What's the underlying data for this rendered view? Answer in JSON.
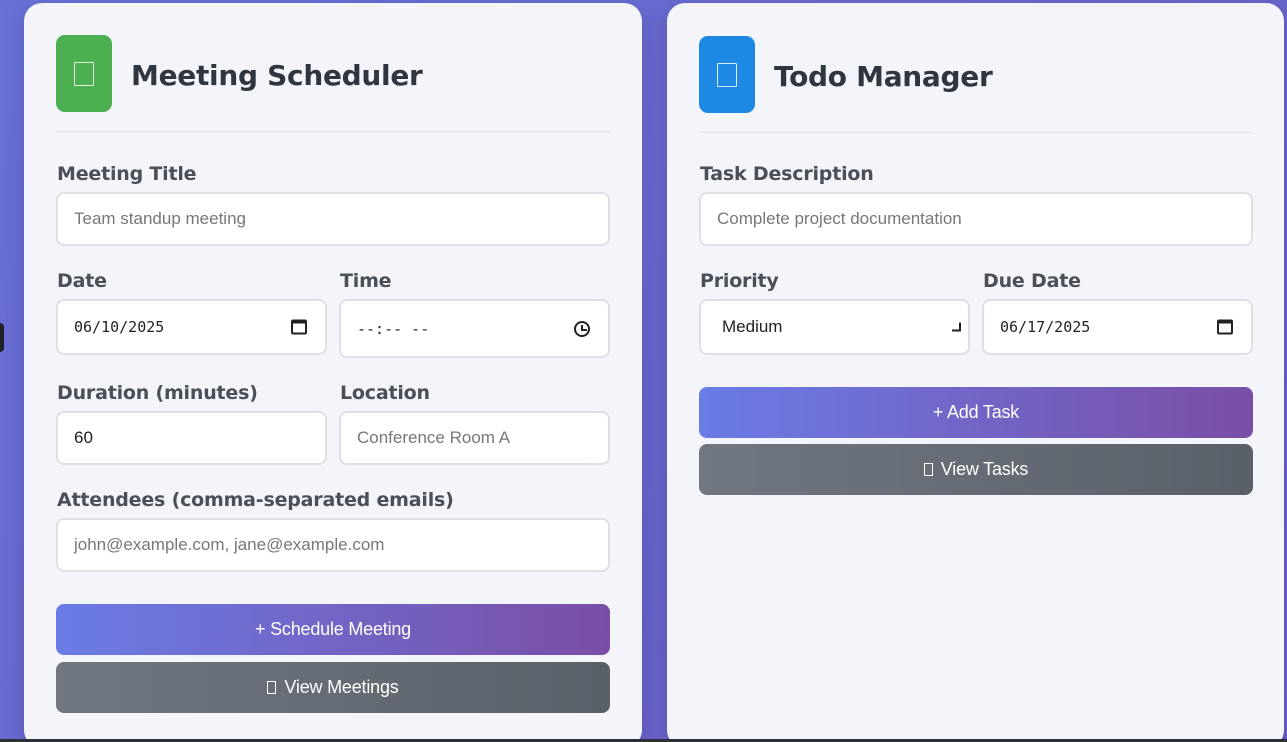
{
  "meeting": {
    "title": "Meeting Scheduler",
    "icon": "calendar-icon",
    "accent": "#4caf50",
    "fields": {
      "title_label": "Meeting Title",
      "title_placeholder": "Team standup meeting",
      "date_label": "Date",
      "date_value": "06/10/2025",
      "time_label": "Time",
      "time_value": "--:-- --",
      "duration_label": "Duration (minutes)",
      "duration_value": "60",
      "location_label": "Location",
      "location_placeholder": "Conference Room A",
      "attendees_label": "Attendees (comma-separated emails)",
      "attendees_placeholder": "john@example.com, jane@example.com"
    },
    "schedule_button": "+ Schedule Meeting",
    "view_button": "View Meetings"
  },
  "todo": {
    "title": "Todo Manager",
    "icon": "checklist-icon",
    "accent": "#1e88e5",
    "fields": {
      "task_label": "Task Description",
      "task_placeholder": "Complete project documentation",
      "priority_label": "Priority",
      "priority_value": "Medium",
      "due_label": "Due Date",
      "due_value": "06/17/2025"
    },
    "add_button": "+ Add Task",
    "view_button": "View Tasks"
  }
}
